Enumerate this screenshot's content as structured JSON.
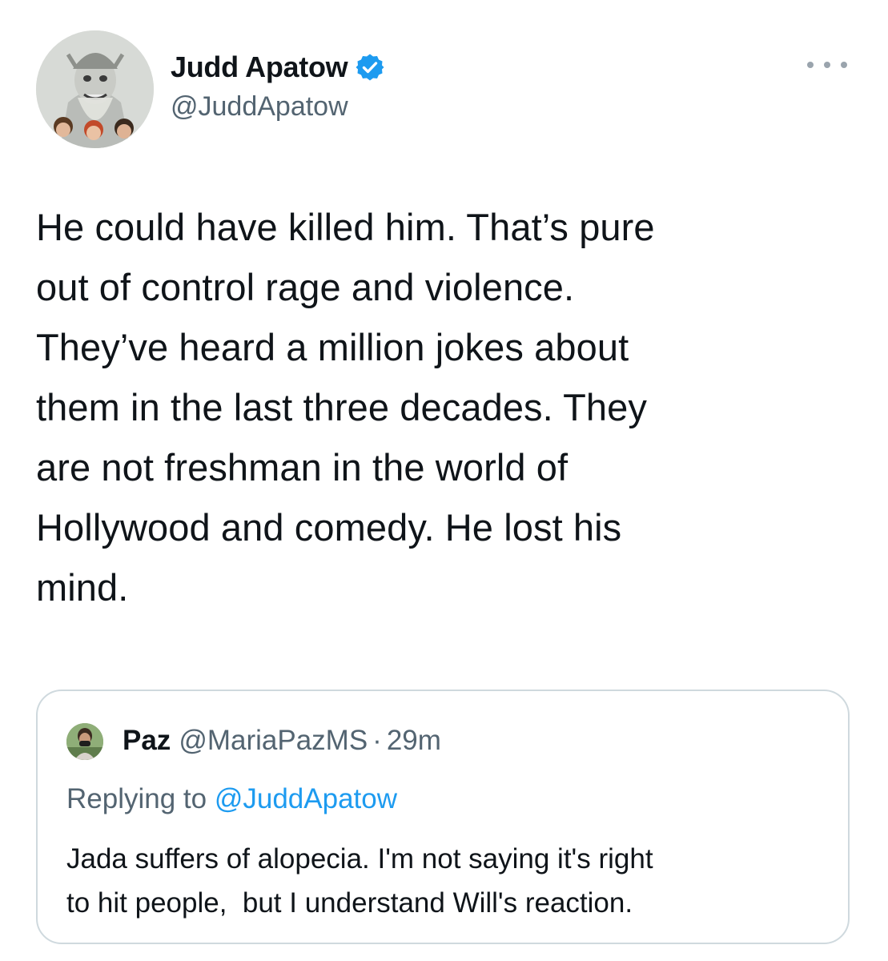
{
  "tweet": {
    "author": {
      "display_name": "Judd Apatow",
      "handle": "@JuddApatow",
      "verified": true,
      "avatar_icon": "avatar-illustration"
    },
    "more_icon": "more-dots-icon",
    "text_lines": [
      "He could have killed him.  That’s pure",
      "out of control rage and violence.",
      "They’ve heard a million jokes about",
      "them in the last three decades.  They",
      "are not freshman in the world of",
      "Hollywood and comedy.  He lost his",
      "mind."
    ]
  },
  "quoted_tweet": {
    "author": {
      "display_name": "Paz",
      "handle": "@MariaPazMS",
      "separator": "·",
      "time": "29m"
    },
    "replying_prefix": "Replying to",
    "replying_to": "@JuddApatow",
    "text_lines": [
      "Jada suffers of alopecia. I'm not saying it's right",
      "to hit people,  but I understand Will's reaction."
    ]
  },
  "colors": {
    "text": "#0f1419",
    "secondary": "#536471",
    "link": "#1d9bf0",
    "border": "#cfd9de",
    "verified_badge": "#1d9bf0"
  }
}
